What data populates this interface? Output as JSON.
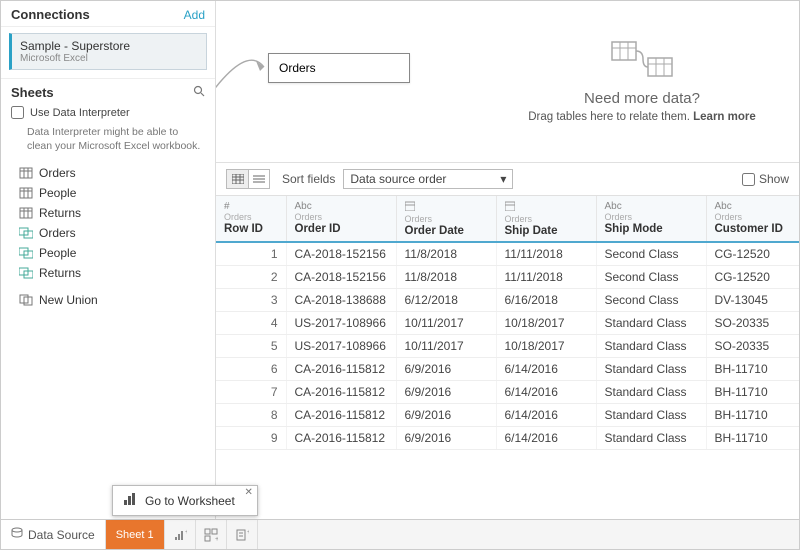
{
  "connections": {
    "title": "Connections",
    "add": "Add",
    "item": {
      "name": "Sample - Superstore",
      "type": "Microsoft Excel"
    }
  },
  "sheets": {
    "title": "Sheets",
    "interp_label": "Use Data Interpreter",
    "interp_desc": "Data Interpreter might be able to clean your Microsoft Excel workbook.",
    "items": [
      {
        "label": "Orders",
        "kind": "grid"
      },
      {
        "label": "People",
        "kind": "grid"
      },
      {
        "label": "Returns",
        "kind": "grid"
      },
      {
        "label": "Orders",
        "kind": "join"
      },
      {
        "label": "People",
        "kind": "join"
      },
      {
        "label": "Returns",
        "kind": "join"
      }
    ],
    "new_union": "New Union"
  },
  "canvas": {
    "table_pill": "Orders",
    "need_title": "Need more data?",
    "need_sub_a": "Drag tables here to relate them. ",
    "need_sub_b": "Learn more"
  },
  "toolbar": {
    "sort_label": "Sort fields",
    "sort_value": "Data source order",
    "show_label": "Show"
  },
  "columns": [
    {
      "dtype": "#",
      "src": "Orders",
      "name": "Row ID"
    },
    {
      "dtype": "Abc",
      "src": "Orders",
      "name": "Order ID"
    },
    {
      "dtype": "📅",
      "src": "Orders",
      "name": "Order Date"
    },
    {
      "dtype": "📅",
      "src": "Orders",
      "name": "Ship Date"
    },
    {
      "dtype": "Abc",
      "src": "Orders",
      "name": "Ship Mode"
    },
    {
      "dtype": "Abc",
      "src": "Orders",
      "name": "Customer ID"
    }
  ],
  "rows": [
    {
      "r": "1",
      "oid": "CA-2018-152156",
      "od": "11/8/2018",
      "sd": "11/11/2018",
      "sm": "Second Class",
      "cid": "CG-12520"
    },
    {
      "r": "2",
      "oid": "CA-2018-152156",
      "od": "11/8/2018",
      "sd": "11/11/2018",
      "sm": "Second Class",
      "cid": "CG-12520"
    },
    {
      "r": "3",
      "oid": "CA-2018-138688",
      "od": "6/12/2018",
      "sd": "6/16/2018",
      "sm": "Second Class",
      "cid": "DV-13045"
    },
    {
      "r": "4",
      "oid": "US-2017-108966",
      "od": "10/11/2017",
      "sd": "10/18/2017",
      "sm": "Standard Class",
      "cid": "SO-20335"
    },
    {
      "r": "5",
      "oid": "US-2017-108966",
      "od": "10/11/2017",
      "sd": "10/18/2017",
      "sm": "Standard Class",
      "cid": "SO-20335"
    },
    {
      "r": "6",
      "oid": "CA-2016-115812",
      "od": "6/9/2016",
      "sd": "6/14/2016",
      "sm": "Standard Class",
      "cid": "BH-11710"
    },
    {
      "r": "7",
      "oid": "CA-2016-115812",
      "od": "6/9/2016",
      "sd": "6/14/2016",
      "sm": "Standard Class",
      "cid": "BH-11710"
    },
    {
      "r": "8",
      "oid": "CA-2016-115812",
      "od": "6/9/2016",
      "sd": "6/14/2016",
      "sm": "Standard Class",
      "cid": "BH-11710"
    },
    {
      "r": "9",
      "oid": "CA-2016-115812",
      "od": "6/9/2016",
      "sd": "6/14/2016",
      "sm": "Standard Class",
      "cid": "BH-11710"
    }
  ],
  "tabs": {
    "data_source": "Data Source",
    "sheet1": "Sheet 1"
  },
  "tooltip": {
    "text": "Go to Worksheet"
  },
  "colwidths": [
    "70",
    "110",
    "100",
    "100",
    "110",
    "96"
  ]
}
